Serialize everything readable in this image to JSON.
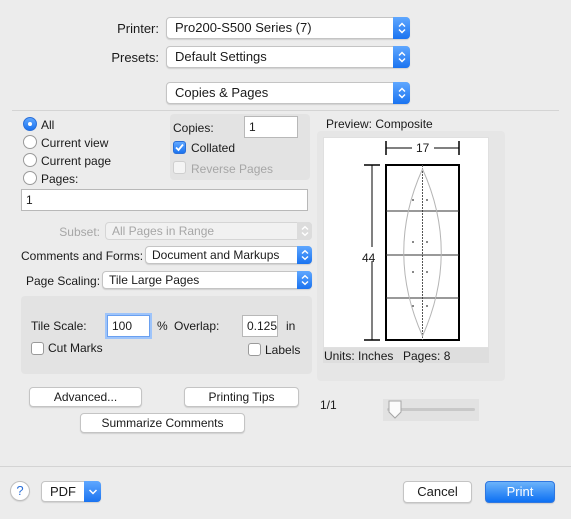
{
  "header": {
    "printer_label": "Printer:",
    "printer_value": "Pro200-S500 Series (7)",
    "presets_label": "Presets:",
    "presets_value": "Default Settings",
    "section_value": "Copies & Pages"
  },
  "pages": {
    "radios": [
      {
        "label": "All",
        "selected": true
      },
      {
        "label": "Current view",
        "selected": false
      },
      {
        "label": "Current page",
        "selected": false
      },
      {
        "label": "Pages:",
        "selected": false
      }
    ],
    "pages_field_value": "1",
    "copies_label": "Copies:",
    "copies_value": "1",
    "collated_label": "Collated",
    "collated_checked": true,
    "reverse_label": "Reverse Pages",
    "reverse_checked": false,
    "subset_label": "Subset:",
    "subset_value": "All Pages in Range",
    "comments_label": "Comments and Forms:",
    "comments_value": "Document and Markups",
    "scaling_label": "Page Scaling:",
    "scaling_value": "Tile Large Pages"
  },
  "tile": {
    "scale_label": "Tile Scale:",
    "scale_value": "100",
    "percent": "%",
    "overlap_label": "Overlap:",
    "overlap_value": "0.125",
    "overlap_unit": "in",
    "cut_marks_label": "Cut Marks",
    "cut_marks_checked": false,
    "labels_label": "Labels",
    "labels_checked": false
  },
  "buttons": {
    "advanced": "Advanced...",
    "printing_tips": "Printing Tips",
    "summarize": "Summarize Comments"
  },
  "preview": {
    "title": "Preview: Composite",
    "width_label": "17",
    "height_label": "44",
    "units": "Units: Inches",
    "pages_count": "Pages: 8",
    "page_indicator": "1/1",
    "slider_value": 0
  },
  "footer": {
    "help": "?",
    "pdf": "PDF",
    "cancel": "Cancel",
    "print": "Print"
  },
  "colors": {
    "accent": "#1a73f0",
    "window_bg": "#ececec"
  }
}
